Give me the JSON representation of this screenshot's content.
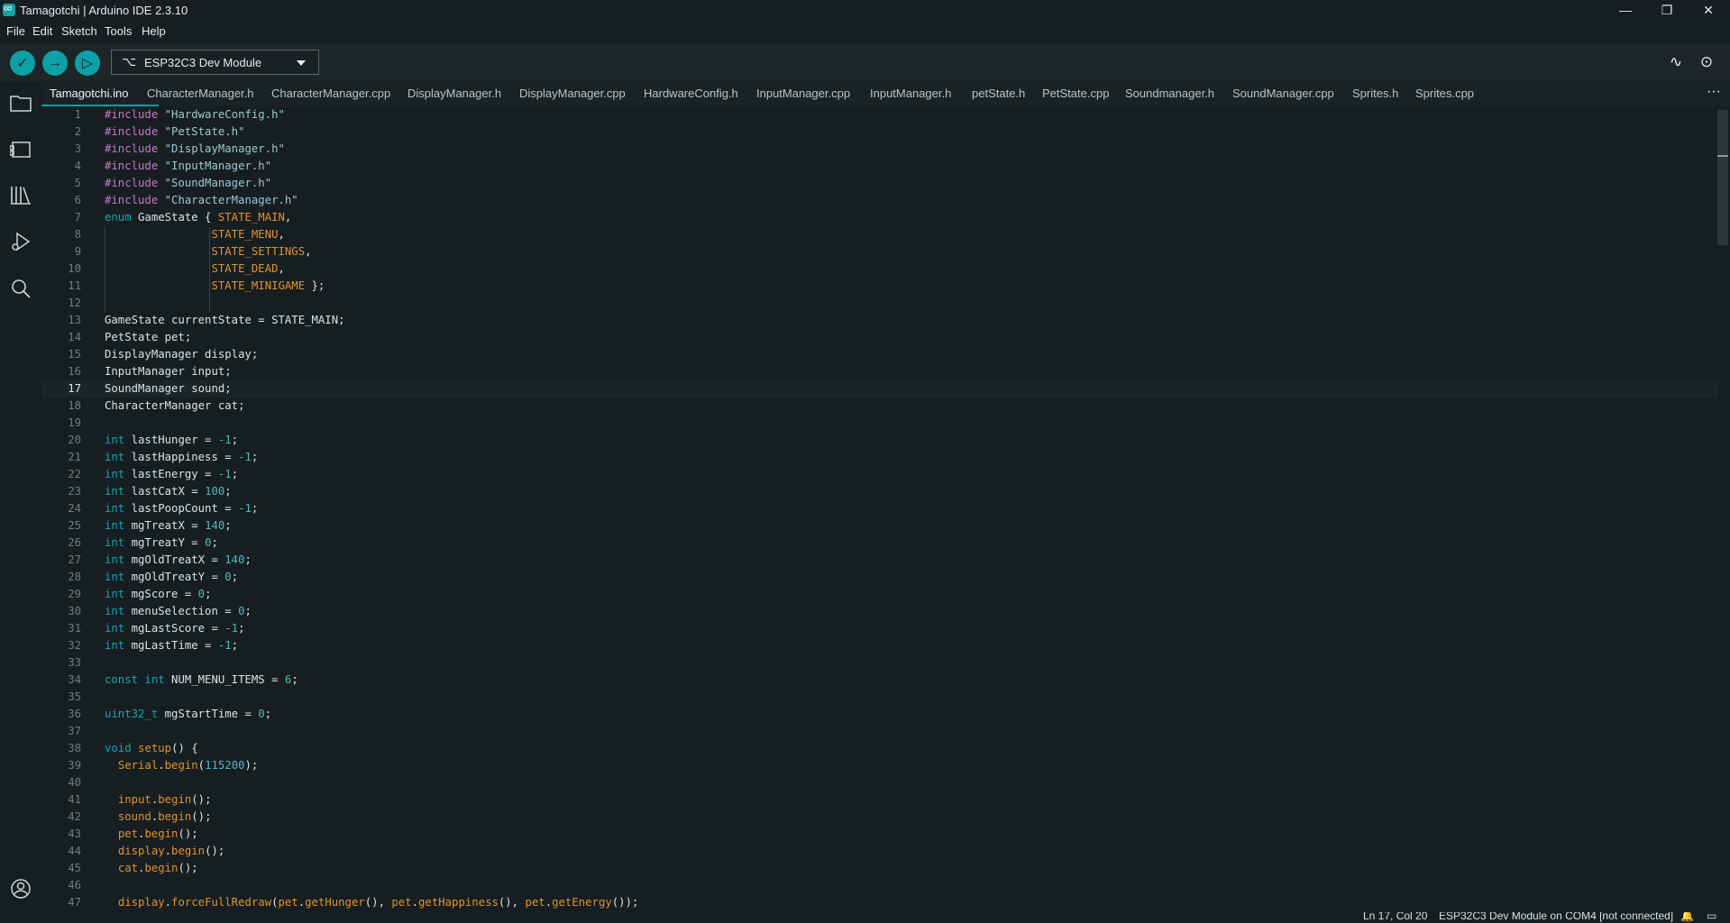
{
  "window": {
    "title": "Tamagotchi | Arduino IDE 2.3.10",
    "minimize_glyph": "—",
    "restore_glyph": "❐",
    "close_glyph": "✕"
  },
  "menu": [
    "File",
    "Edit",
    "Sketch",
    "Tools",
    "Help"
  ],
  "toolbar": {
    "verify_glyph": "✓",
    "upload_glyph": "→",
    "debug_glyph": "▷",
    "board_label": "ESP32C3 Dev Module",
    "usb_glyph": "⌥",
    "plotter_glyph": "∿",
    "monitor_glyph": "⊙"
  },
  "tabs": [
    "Tamagotchi.ino",
    "CharacterManager.h",
    "CharacterManager.cpp",
    "DisplayManager.h",
    "DisplayManager.cpp",
    "HardwareConfig.h",
    "InputManager.cpp",
    "InputManager.h",
    "petState.h",
    "PetState.cpp",
    "Soundmanager.h",
    "SoundManager.cpp",
    "Sprites.h",
    "Sprites.cpp"
  ],
  "tab_more_glyph": "···",
  "editor": {
    "current_line": 17,
    "lines": [
      [
        [
          "pp",
          "#include "
        ],
        [
          "str",
          "\"HardwareConfig.h\""
        ]
      ],
      [
        [
          "pp",
          "#include "
        ],
        [
          "str",
          "\"PetState.h\""
        ]
      ],
      [
        [
          "pp",
          "#include "
        ],
        [
          "str",
          "\"DisplayManager.h\""
        ]
      ],
      [
        [
          "pp",
          "#include "
        ],
        [
          "str",
          "\"InputManager.h\""
        ]
      ],
      [
        [
          "pp",
          "#include "
        ],
        [
          "str",
          "\"SoundManager.h\""
        ]
      ],
      [
        [
          "pp",
          "#include "
        ],
        [
          "str",
          "\"CharacterManager.h\""
        ]
      ],
      [
        [
          "kw",
          "enum"
        ],
        [
          "t",
          " GameState { "
        ],
        [
          "const",
          "STATE_MAIN"
        ],
        [
          "t",
          ","
        ]
      ],
      [
        [
          "t",
          "                "
        ],
        [
          "const",
          "STATE_MENU"
        ],
        [
          "t",
          ","
        ]
      ],
      [
        [
          "t",
          "                "
        ],
        [
          "const",
          "STATE_SETTINGS"
        ],
        [
          "t",
          ","
        ]
      ],
      [
        [
          "t",
          "                "
        ],
        [
          "const",
          "STATE_DEAD"
        ],
        [
          "t",
          ","
        ]
      ],
      [
        [
          "t",
          "                "
        ],
        [
          "const",
          "STATE_MINIGAME"
        ],
        [
          "t",
          " };"
        ]
      ],
      [],
      [
        [
          "t",
          "GameState currentState = STATE_MAIN;"
        ]
      ],
      [
        [
          "t",
          "PetState pet;"
        ]
      ],
      [
        [
          "t",
          "DisplayManager display;"
        ]
      ],
      [
        [
          "t",
          "InputManager input;"
        ]
      ],
      [
        [
          "t",
          "SoundManager sound;"
        ]
      ],
      [
        [
          "t",
          "CharacterManager cat;"
        ]
      ],
      [],
      [
        [
          "kw",
          "int"
        ],
        [
          "t",
          " lastHunger = "
        ],
        [
          "num",
          "-1"
        ],
        [
          "t",
          ";"
        ]
      ],
      [
        [
          "kw",
          "int"
        ],
        [
          "t",
          " lastHappiness = "
        ],
        [
          "num",
          "-1"
        ],
        [
          "t",
          ";"
        ]
      ],
      [
        [
          "kw",
          "int"
        ],
        [
          "t",
          " lastEnergy = "
        ],
        [
          "num",
          "-1"
        ],
        [
          "t",
          ";"
        ]
      ],
      [
        [
          "kw",
          "int"
        ],
        [
          "t",
          " lastCatX = "
        ],
        [
          "num",
          "100"
        ],
        [
          "t",
          ";"
        ]
      ],
      [
        [
          "kw",
          "int"
        ],
        [
          "t",
          " lastPoopCount = "
        ],
        [
          "num",
          "-1"
        ],
        [
          "t",
          ";"
        ]
      ],
      [
        [
          "kw",
          "int"
        ],
        [
          "t",
          " mgTreatX = "
        ],
        [
          "num",
          "140"
        ],
        [
          "t",
          ";"
        ]
      ],
      [
        [
          "kw",
          "int"
        ],
        [
          "t",
          " mgTreatY = "
        ],
        [
          "num",
          "0"
        ],
        [
          "t",
          ";"
        ]
      ],
      [
        [
          "kw",
          "int"
        ],
        [
          "t",
          " mgOldTreatX = "
        ],
        [
          "num",
          "140"
        ],
        [
          "t",
          ";"
        ]
      ],
      [
        [
          "kw",
          "int"
        ],
        [
          "t",
          " mgOldTreatY = "
        ],
        [
          "num",
          "0"
        ],
        [
          "t",
          ";"
        ]
      ],
      [
        [
          "kw",
          "int"
        ],
        [
          "t",
          " mgScore = "
        ],
        [
          "num",
          "0"
        ],
        [
          "t",
          ";"
        ]
      ],
      [
        [
          "kw",
          "int"
        ],
        [
          "t",
          " menuSelection = "
        ],
        [
          "num",
          "0"
        ],
        [
          "t",
          ";"
        ]
      ],
      [
        [
          "kw",
          "int"
        ],
        [
          "t",
          " mgLastScore = "
        ],
        [
          "num",
          "-1"
        ],
        [
          "t",
          ";"
        ]
      ],
      [
        [
          "kw",
          "int"
        ],
        [
          "t",
          " mgLastTime = "
        ],
        [
          "num",
          "-1"
        ],
        [
          "t",
          ";"
        ]
      ],
      [],
      [
        [
          "kw",
          "const int"
        ],
        [
          "t",
          " NUM_MENU_ITEMS = "
        ],
        [
          "num",
          "6"
        ],
        [
          "t",
          ";"
        ]
      ],
      [],
      [
        [
          "kw",
          "uint32_t"
        ],
        [
          "t",
          " mgStartTime = "
        ],
        [
          "num",
          "0"
        ],
        [
          "t",
          ";"
        ]
      ],
      [],
      [
        [
          "kw",
          "void"
        ],
        [
          "t",
          " "
        ],
        [
          "fn",
          "setup"
        ],
        [
          "t",
          "() {"
        ]
      ],
      [
        [
          "t",
          "  "
        ],
        [
          "fn",
          "Serial"
        ],
        [
          "t",
          "."
        ],
        [
          "fn",
          "begin"
        ],
        [
          "t",
          "("
        ],
        [
          "num",
          "115200"
        ],
        [
          "t",
          ");"
        ]
      ],
      [],
      [
        [
          "t",
          "  "
        ],
        [
          "fn",
          "input"
        ],
        [
          "t",
          "."
        ],
        [
          "fn",
          "begin"
        ],
        [
          "t",
          "();"
        ]
      ],
      [
        [
          "t",
          "  "
        ],
        [
          "fn",
          "sound"
        ],
        [
          "t",
          "."
        ],
        [
          "fn",
          "begin"
        ],
        [
          "t",
          "();"
        ]
      ],
      [
        [
          "t",
          "  "
        ],
        [
          "fn",
          "pet"
        ],
        [
          "t",
          "."
        ],
        [
          "fn",
          "begin"
        ],
        [
          "t",
          "();"
        ]
      ],
      [
        [
          "t",
          "  "
        ],
        [
          "fn",
          "display"
        ],
        [
          "t",
          "."
        ],
        [
          "fn",
          "begin"
        ],
        [
          "t",
          "();"
        ]
      ],
      [
        [
          "t",
          "  "
        ],
        [
          "fn",
          "cat"
        ],
        [
          "t",
          "."
        ],
        [
          "fn",
          "begin"
        ],
        [
          "t",
          "();"
        ]
      ],
      [],
      [
        [
          "t",
          "  "
        ],
        [
          "fn",
          "display"
        ],
        [
          "t",
          "."
        ],
        [
          "fn",
          "forceFullRedraw"
        ],
        [
          "t",
          "("
        ],
        [
          "fn",
          "pet"
        ],
        [
          "t",
          "."
        ],
        [
          "fn",
          "getHunger"
        ],
        [
          "t",
          "(), "
        ],
        [
          "fn",
          "pet"
        ],
        [
          "t",
          "."
        ],
        [
          "fn",
          "getHappiness"
        ],
        [
          "t",
          "(), "
        ],
        [
          "fn",
          "pet"
        ],
        [
          "t",
          "."
        ],
        [
          "fn",
          "getEnergy"
        ],
        [
          "t",
          "());"
        ]
      ]
    ]
  },
  "status": {
    "position": "Ln 17, Col 20",
    "board": "ESP32C3 Dev Module on COM4 [not connected]"
  },
  "colors": {
    "accent": "#0ca1a6",
    "preprocessor": "#c678c9",
    "string": "#9cc9d4",
    "keyword": "#11a7b5",
    "constant": "#e0922f",
    "number": "#4fb9be"
  }
}
